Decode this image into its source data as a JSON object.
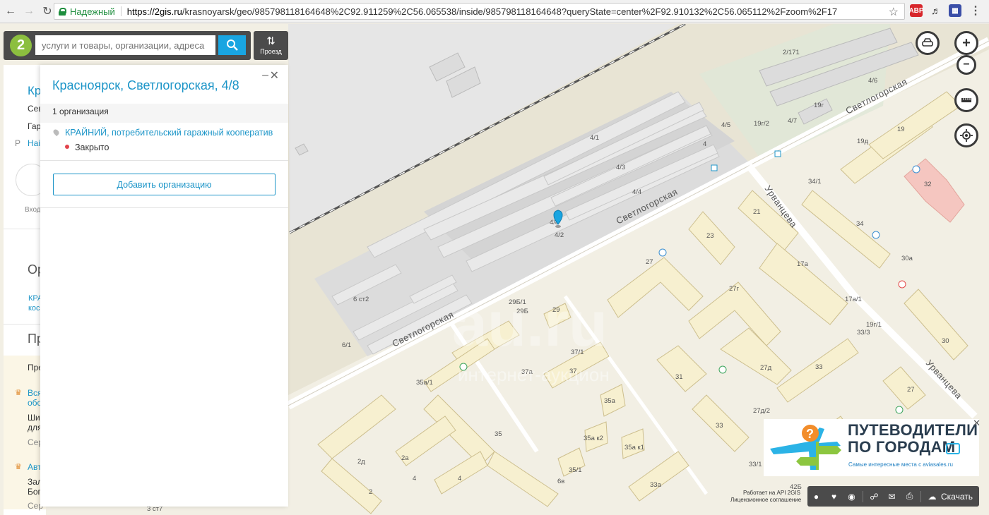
{
  "browser": {
    "secure_label": "Надежный",
    "url_host": "https://2gis.ru",
    "url_path": "/krasnoyarsk/geo/985798118164648%2C92.911259%2C56.065538/inside/985798118164648?queryState=center%2F92.910132%2C56.065112%2Fzoom%2F17"
  },
  "search": {
    "placeholder": "услуги и товары, организации, адреса",
    "logo": "2",
    "route_label": "Проезд"
  },
  "back_panel": {
    "rows": [
      "Кр",
      "Сев",
      "Гар",
      "Наі",
      "Вход",
      "Ор",
      "КРА",
      "кос",
      "Пр",
      "Пре",
      "Вся",
      "обо",
      "Ши",
      "для",
      "Сер",
      "Авт",
      "Зал",
      "Бог",
      "Сер"
    ],
    "p_marker": "Р"
  },
  "card": {
    "title": "Красноярск, Светлогорская, 4/8",
    "org_count": "1 организация",
    "org_name": "КРАЙНИЙ, потребительский гаражный кооператив",
    "status": "Закрыто",
    "add_button": "Добавить организацию",
    "colors": {
      "link": "#1c95c8",
      "closed": "#e2434b"
    }
  },
  "map": {
    "streets": [
      "Светлогорская",
      "Светлогорская",
      "Светлогорская",
      "Урванцева",
      "Урванцева"
    ],
    "buildings": [
      "2/171",
      "4/6",
      "19г",
      "4/5",
      "19г/2",
      "4/7",
      "4/1",
      "4",
      "4/3",
      "4/4",
      "19",
      "19д",
      "34/1",
      "32",
      "21",
      "34",
      "4/8",
      "4/2",
      "23",
      "27",
      "17а",
      "30а",
      "27г",
      "6 ст2",
      "29Б/1",
      "29Б",
      "29",
      "17а/1",
      "19г/1",
      "33/3",
      "30",
      "6/1",
      "37/1",
      "27д",
      "33",
      "35а/1",
      "37а",
      "37",
      "31",
      "35а",
      "27",
      "27д/2",
      "33",
      "35а к2",
      "35а к1",
      "2а",
      "2д",
      "35",
      "4",
      "4",
      "35/1",
      "33/1",
      "6в",
      "33а",
      "2",
      "42Б",
      "3 ст7"
    ],
    "watermark": "au.ru",
    "watermark_sub": "интернет-аукцион"
  },
  "ad": {
    "title_line1": "ПУТЕВОДИТЕЛИ",
    "title_line2": "ПО ГОРОДАМ",
    "subtitle": "Самые интересные места с aviasales.ru"
  },
  "toolbar": {
    "download": "Скачать"
  },
  "attribution": {
    "line1": "Работает на API 2GIS",
    "line2": "Лицензионное соглашение"
  }
}
